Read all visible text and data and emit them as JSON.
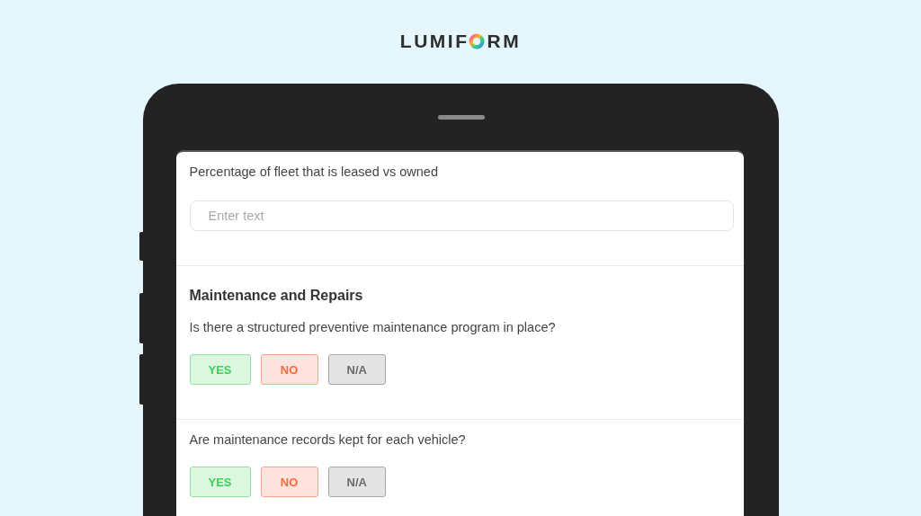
{
  "logo": {
    "before": "LUMIF",
    "after": "RM"
  },
  "sections": [
    {
      "kind": "text",
      "question": "Percentage of fleet that is leased vs owned",
      "input": {
        "placeholder": "Enter text"
      }
    },
    {
      "kind": "choice",
      "heading": "Maintenance and Repairs",
      "question": "Is there a structured preventive maintenance program in place?",
      "options": [
        {
          "kind": "yes",
          "label": "YES",
          "selected": false
        },
        {
          "kind": "no",
          "label": "NO",
          "selected": false
        },
        {
          "kind": "na",
          "label": "N/A",
          "selected": false
        }
      ]
    },
    {
      "kind": "choice",
      "question": "Are maintenance records kept for each vehicle?",
      "options": [
        {
          "kind": "yes",
          "label": "YES",
          "selected": false
        },
        {
          "kind": "no",
          "label": "NO",
          "selected": false
        },
        {
          "kind": "na",
          "label": "N/A",
          "selected": false
        }
      ]
    }
  ]
}
